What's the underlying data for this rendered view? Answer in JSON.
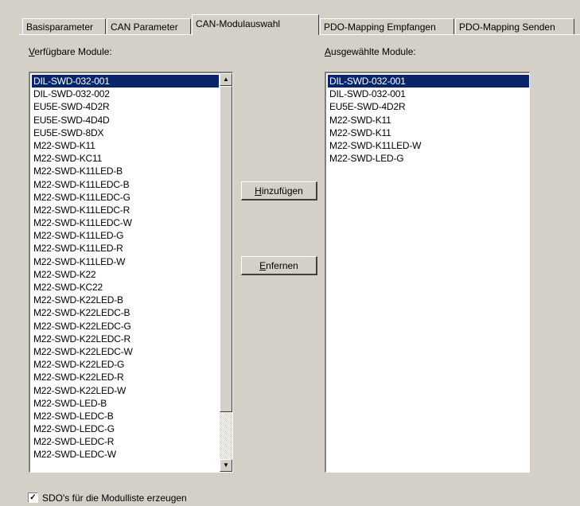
{
  "tabs": [
    {
      "label": "Basisparameter",
      "active": false
    },
    {
      "label": "CAN Parameter",
      "active": false
    },
    {
      "label": "CAN-Modulauswahl",
      "active": true
    },
    {
      "label": "PDO-Mapping Empfangen",
      "active": false
    },
    {
      "label": "PDO-Mapping Senden",
      "active": false
    }
  ],
  "available": {
    "label_mnemonic": "V",
    "label_rest": "erfügbare Module:",
    "selected_index": 0,
    "items": [
      "DIL-SWD-032-001",
      "DIL-SWD-032-002",
      "EU5E-SWD-4D2R",
      "EU5E-SWD-4D4D",
      "EU5E-SWD-8DX",
      "M22-SWD-K11",
      "M22-SWD-KC11",
      "M22-SWD-K11LED-B",
      "M22-SWD-K11LEDC-B",
      "M22-SWD-K11LEDC-G",
      "M22-SWD-K11LEDC-R",
      "M22-SWD-K11LEDC-W",
      "M22-SWD-K11LED-G",
      "M22-SWD-K11LED-R",
      "M22-SWD-K11LED-W",
      "M22-SWD-K22",
      "M22-SWD-KC22",
      "M22-SWD-K22LED-B",
      "M22-SWD-K22LEDC-B",
      "M22-SWD-K22LEDC-G",
      "M22-SWD-K22LEDC-R",
      "M22-SWD-K22LEDC-W",
      "M22-SWD-K22LED-G",
      "M22-SWD-K22LED-R",
      "M22-SWD-K22LED-W",
      "M22-SWD-LED-B",
      "M22-SWD-LEDC-B",
      "M22-SWD-LEDC-G",
      "M22-SWD-LEDC-R",
      "M22-SWD-LEDC-W"
    ]
  },
  "selected": {
    "label_mnemonic": "A",
    "label_rest": "usgewählte Module:",
    "selected_index": 0,
    "items": [
      "DIL-SWD-032-001",
      "DIL-SWD-032-001",
      "EU5E-SWD-4D2R",
      "M22-SWD-K11",
      "M22-SWD-K11",
      "M22-SWD-K11LED-W",
      "M22-SWD-LED-G"
    ]
  },
  "buttons": {
    "add_mnemonic": "H",
    "add_rest": "inzufügen",
    "remove_mnemonic": "E",
    "remove_rest": "nfernen"
  },
  "checkbox": {
    "checked": true,
    "mark": "✓",
    "label": "SDO's für die Modulliste erzeugen"
  },
  "icons": {
    "scroll_up": "scroll-up-arrow-icon",
    "scroll_down": "scroll-down-arrow-icon",
    "up_glyph": "▲",
    "down_glyph": "▼"
  }
}
